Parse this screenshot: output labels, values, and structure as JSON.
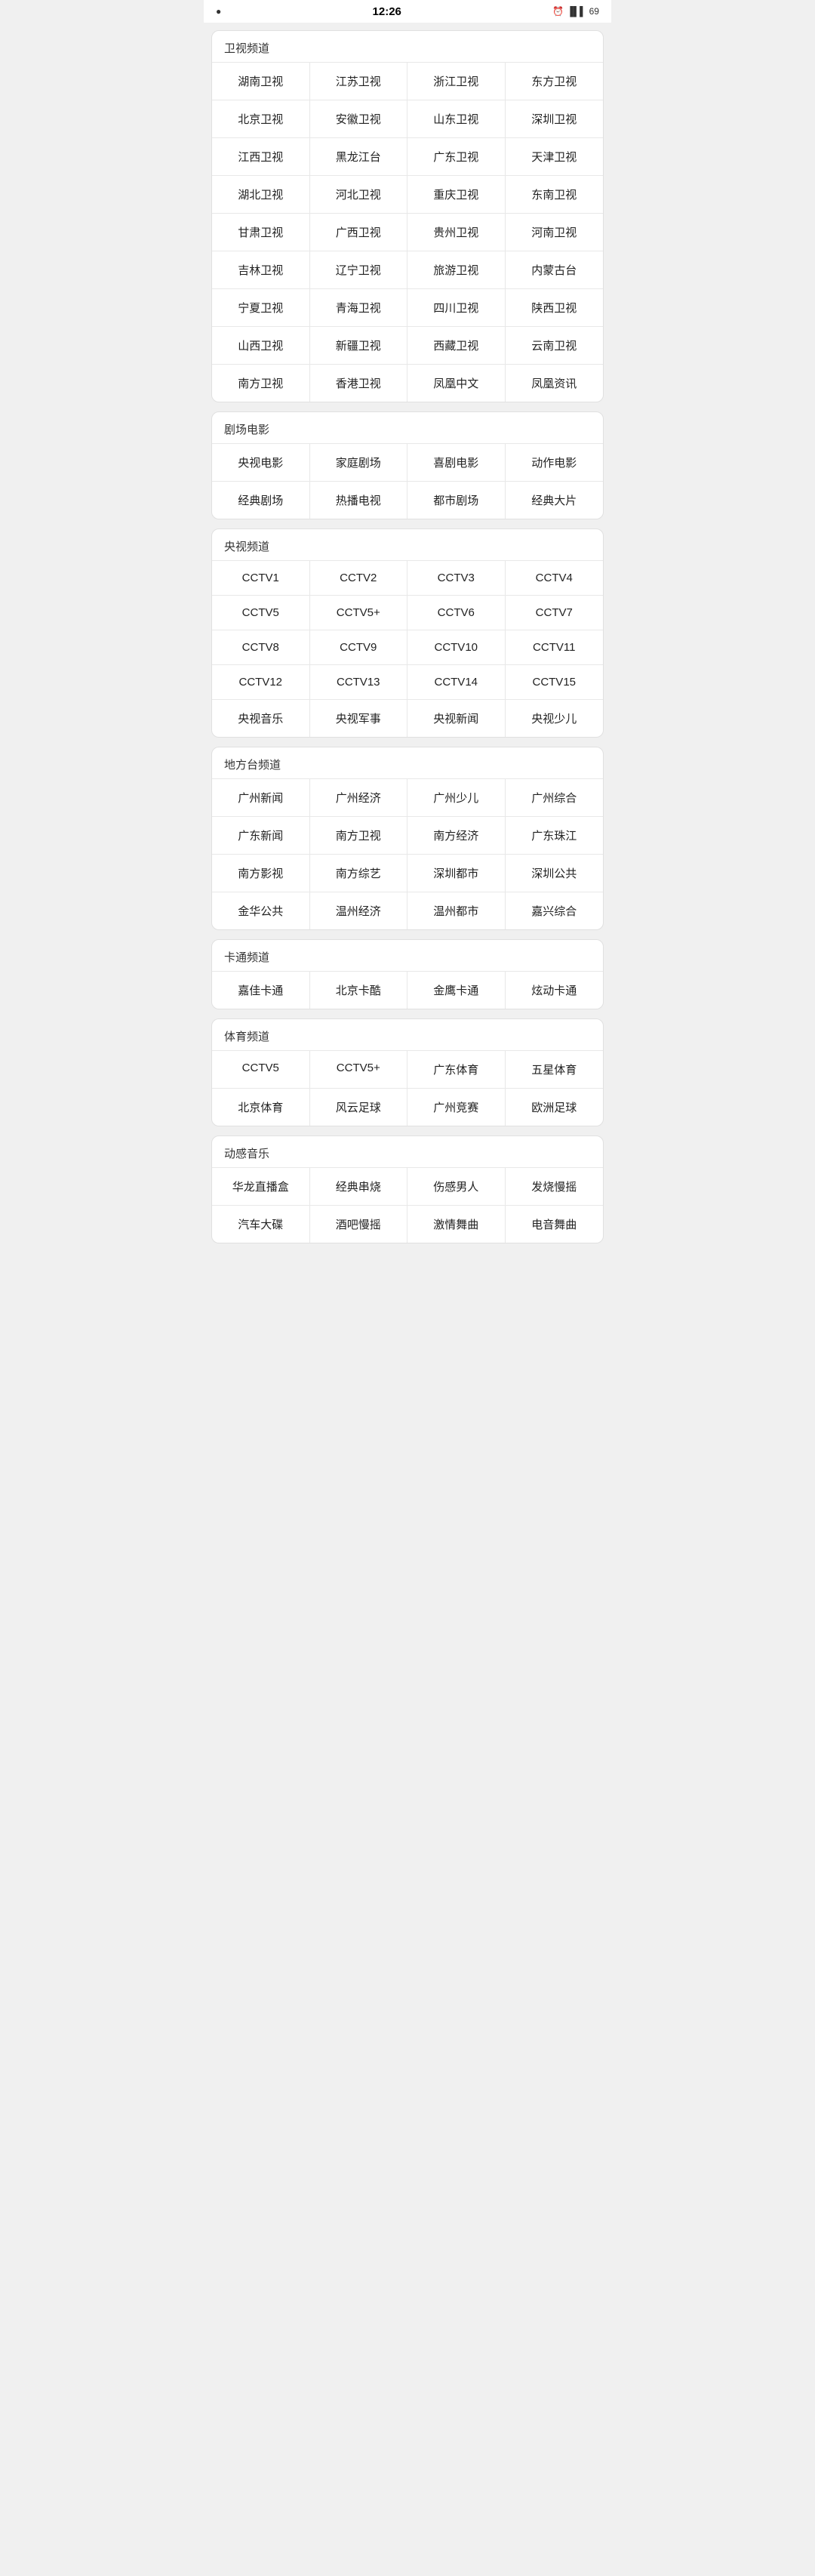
{
  "statusBar": {
    "left": "●",
    "time": "12:26",
    "right": "📶 69"
  },
  "sections": [
    {
      "id": "satellite",
      "title": "卫视频道",
      "items": [
        "湖南卫视",
        "江苏卫视",
        "浙江卫视",
        "东方卫视",
        "北京卫视",
        "安徽卫视",
        "山东卫视",
        "深圳卫视",
        "江西卫视",
        "黑龙江台",
        "广东卫视",
        "天津卫视",
        "湖北卫视",
        "河北卫视",
        "重庆卫视",
        "东南卫视",
        "甘肃卫视",
        "广西卫视",
        "贵州卫视",
        "河南卫视",
        "吉林卫视",
        "辽宁卫视",
        "旅游卫视",
        "内蒙古台",
        "宁夏卫视",
        "青海卫视",
        "四川卫视",
        "陕西卫视",
        "山西卫视",
        "新疆卫视",
        "西藏卫视",
        "云南卫视",
        "南方卫视",
        "香港卫视",
        "凤凰中文",
        "凤凰资讯"
      ]
    },
    {
      "id": "theater",
      "title": "剧场电影",
      "items": [
        "央视电影",
        "家庭剧场",
        "喜剧电影",
        "动作电影",
        "经典剧场",
        "热播电视",
        "都市剧场",
        "经典大片"
      ]
    },
    {
      "id": "cctv",
      "title": "央视频道",
      "items": [
        "CCTV1",
        "CCTV2",
        "CCTV3",
        "CCTV4",
        "CCTV5",
        "CCTV5+",
        "CCTV6",
        "CCTV7",
        "CCTV8",
        "CCTV9",
        "CCTV10",
        "CCTV11",
        "CCTV12",
        "CCTV13",
        "CCTV14",
        "CCTV15",
        "央视音乐",
        "央视军事",
        "央视新闻",
        "央视少儿"
      ]
    },
    {
      "id": "local",
      "title": "地方台频道",
      "items": [
        "广州新闻",
        "广州经济",
        "广州少儿",
        "广州综合",
        "广东新闻",
        "南方卫视",
        "南方经济",
        "广东珠江",
        "南方影视",
        "南方综艺",
        "深圳都市",
        "深圳公共",
        "金华公共",
        "温州经济",
        "温州都市",
        "嘉兴综合"
      ]
    },
    {
      "id": "cartoon",
      "title": "卡通频道",
      "items": [
        "嘉佳卡通",
        "北京卡酷",
        "金鹰卡通",
        "炫动卡通"
      ]
    },
    {
      "id": "sports",
      "title": "体育频道",
      "items": [
        "CCTV5",
        "CCTV5+",
        "广东体育",
        "五星体育",
        "北京体育",
        "风云足球",
        "广州竞赛",
        "欧洲足球"
      ]
    },
    {
      "id": "music",
      "title": "动感音乐",
      "items": [
        "华龙直播盒",
        "经典串烧",
        "伤感男人",
        "发烧慢摇",
        "汽车大碟",
        "酒吧慢摇",
        "激情舞曲",
        "电音舞曲"
      ]
    }
  ]
}
